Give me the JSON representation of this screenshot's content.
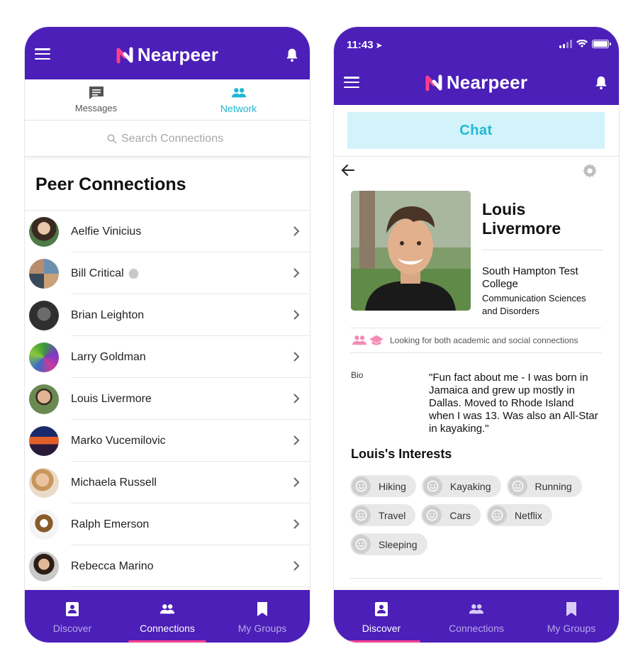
{
  "brand": {
    "name": "Nearpeer"
  },
  "colors": {
    "primary": "#4b1fb8",
    "accent": "#1fb8d4",
    "highlight": "#ff3f8e",
    "tab_inactive": "#b8a8e8"
  },
  "left_screen": {
    "tabs": [
      {
        "label": "Messages",
        "icon": "message-icon"
      },
      {
        "label": "Network",
        "icon": "people-icon",
        "active": true
      }
    ],
    "search": {
      "placeholder": "Search Connections"
    },
    "section_title": "Peer Connections",
    "contacts": [
      {
        "name": "Aelfie Vinicius"
      },
      {
        "name": "Bill Critical",
        "badge": "verified-icon"
      },
      {
        "name": "Brian Leighton"
      },
      {
        "name": "Larry Goldman"
      },
      {
        "name": "Louis Livermore"
      },
      {
        "name": "Marko Vucemilovic"
      },
      {
        "name": "Michaela Russell"
      },
      {
        "name": "Ralph Emerson"
      },
      {
        "name": "Rebecca Marino"
      }
    ],
    "tabbar": [
      {
        "label": "Discover",
        "icon": "discover-icon"
      },
      {
        "label": "Connections",
        "icon": "connections-icon",
        "active": true
      },
      {
        "label": "My Groups",
        "icon": "bookmark-icon"
      }
    ]
  },
  "right_screen": {
    "status_bar": {
      "time": "11:43"
    },
    "chat_button": "Chat",
    "profile": {
      "name": "Louis Livermore",
      "school": "South Hampton Test College",
      "major": "Communication Sciences and Disorders",
      "looking_for": "Looking for both academic and social connections",
      "bio_label": "Bio",
      "bio": "\"Fun fact about me - I was born in Jamaica and grew up mostly in Dallas. Moved to Rhode Island when I was 13. Was also an All-Star in kayaking.\"",
      "interests_title": "Louis's Interests",
      "interests": [
        "Hiking",
        "Kayaking",
        "Running",
        "Travel",
        "Cars",
        "Netflix",
        "Sleeping"
      ]
    },
    "tabbar": [
      {
        "label": "Discover",
        "icon": "discover-icon",
        "active": true
      },
      {
        "label": "Connections",
        "icon": "connections-icon"
      },
      {
        "label": "My Groups",
        "icon": "bookmark-icon"
      }
    ]
  }
}
